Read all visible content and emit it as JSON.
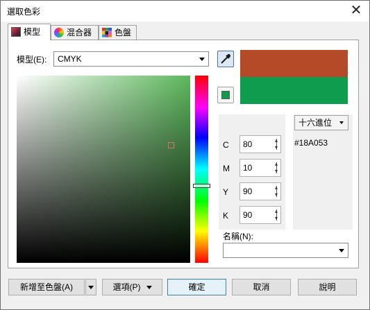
{
  "window": {
    "title": "選取色彩",
    "close_icon": "close-icon"
  },
  "tabs": [
    {
      "label": "模型",
      "icon": "model-icon",
      "active": true
    },
    {
      "label": "混合器",
      "icon": "mixer-icon",
      "active": false
    },
    {
      "label": "色盤",
      "icon": "palette-icon",
      "active": false
    }
  ],
  "model": {
    "label": "模型(E):",
    "value": "CMYK"
  },
  "colors": {
    "reference": "#b44a28",
    "new": "#0f9c4f",
    "accent": "#3c7fb1"
  },
  "components": [
    {
      "label": "C",
      "value": "80"
    },
    {
      "label": "M",
      "value": "10"
    },
    {
      "label": "Y",
      "value": "90"
    },
    {
      "label": "K",
      "value": "90"
    }
  ],
  "hex": {
    "dropdown": "十六進位",
    "value": "#18A053"
  },
  "name": {
    "label": "名稱(N):",
    "value": ""
  },
  "buttons": {
    "add_to_palette": "新增至色盤(A)",
    "options": "選項(P)",
    "ok": "確定",
    "cancel": "取消",
    "help": "說明"
  }
}
